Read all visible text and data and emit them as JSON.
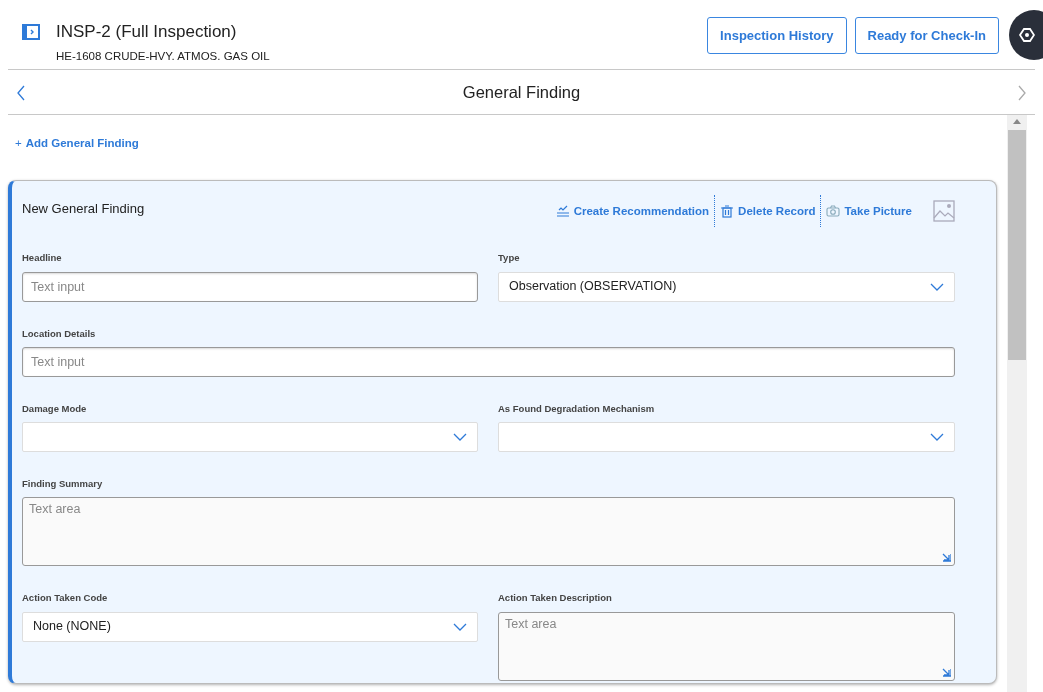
{
  "header": {
    "title": "INSP-2 (Full Inspection)",
    "subtitle": "HE-1608 CRUDE-HVY. ATMOS. GAS OIL",
    "buttons": [
      "Inspection History",
      "Ready for Check-In"
    ]
  },
  "nav": {
    "title": "General Finding"
  },
  "add_link": {
    "icon": "+",
    "label": "Add General Finding"
  },
  "card": {
    "title": "New General Finding",
    "actions": [
      {
        "kind": "recommend",
        "label": "Create Recommendation",
        "disabled": false
      },
      {
        "kind": "delete",
        "label": "Delete Record",
        "disabled": false
      },
      {
        "kind": "camera",
        "label": "Take Picture",
        "disabled": false
      }
    ],
    "fields": [
      {
        "kind": "text",
        "label": "Headline",
        "placeholder": "Text input",
        "full_width": false
      },
      {
        "kind": "select",
        "label": "Type",
        "value": "Observation (OBSERVATION)",
        "full_width": false
      },
      {
        "kind": "text",
        "label": "Location Details",
        "placeholder": "Text input",
        "full_width": true
      },
      {
        "kind": "select",
        "label": "Damage Mode",
        "full_width": false
      },
      {
        "kind": "select",
        "label": "As Found Degradation Mechanism",
        "full_width": false
      },
      {
        "kind": "textarea",
        "label": "Finding Summary",
        "placeholder": "Text area",
        "full_width": true
      },
      {
        "kind": "select",
        "label": "Action Taken Code",
        "value": "None (NONE)",
        "full_width": false
      },
      {
        "kind": "textarea",
        "label": "Action Taken Description",
        "placeholder": "Text area",
        "full_width": false
      }
    ]
  }
}
